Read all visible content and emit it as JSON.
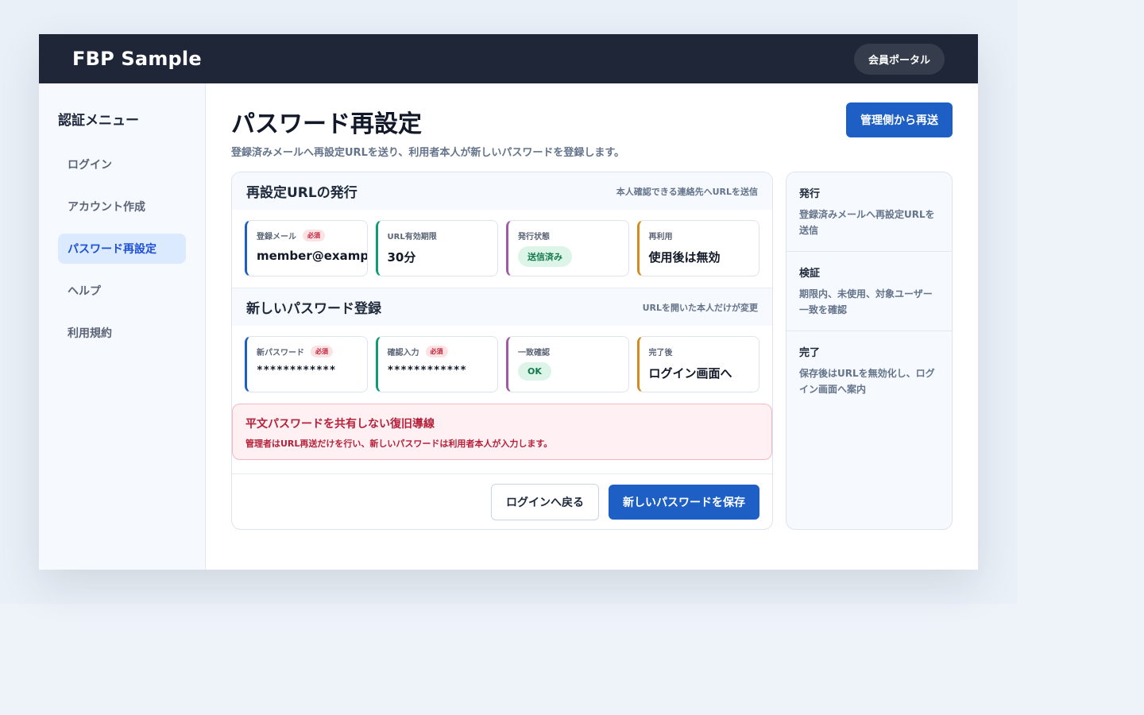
{
  "app": {
    "brand": "FBP Sample",
    "portal_label": "会員ポータル"
  },
  "sidebar": {
    "title": "認証メニュー",
    "items": [
      {
        "label": "ログイン",
        "active": false
      },
      {
        "label": "アカウント作成",
        "active": false
      },
      {
        "label": "パスワード再設定",
        "active": true
      },
      {
        "label": "ヘルプ",
        "active": false
      },
      {
        "label": "利用規約",
        "active": false
      }
    ]
  },
  "page": {
    "title": "パスワード再設定",
    "subtitle": "登録済みメールへ再設定URLを送り、利用者本人が新しいパスワードを登録します。",
    "resend_button": "管理側から再送"
  },
  "issue_section": {
    "title": "再設定URLの発行",
    "note": "本人確認できる連絡先へURLを送信",
    "fields": [
      {
        "label": "登録メール",
        "required_badge": "必須",
        "value": "member@example.com"
      },
      {
        "label": "URL有効期限",
        "value": "30分"
      },
      {
        "label": "発行状態",
        "status": "送信済み"
      },
      {
        "label": "再利用",
        "value": "使用後は無効"
      }
    ]
  },
  "register_section": {
    "title": "新しいパスワード登録",
    "note": "URLを開いた本人だけが変更",
    "fields": [
      {
        "label": "新パスワード",
        "required_badge": "必須",
        "value": "************"
      },
      {
        "label": "確認入力",
        "required_badge": "必須",
        "value": "************"
      },
      {
        "label": "一致確認",
        "status": "OK"
      },
      {
        "label": "完了後",
        "value": "ログイン画面へ"
      }
    ]
  },
  "alert": {
    "title": "平文パスワードを共有しない復旧導線",
    "body": "管理者はURL再送だけを行い、新しいパスワードは利用者本人が入力します。"
  },
  "footer": {
    "back_button": "ログインへ戻る",
    "save_button": "新しいパスワードを保存"
  },
  "steps": [
    {
      "title": "発行",
      "body": "登録済みメールへ再設定URLを送信"
    },
    {
      "title": "検証",
      "body": "期限内、未使用、対象ユーザー一致を確認"
    },
    {
      "title": "完了",
      "body": "保存後はURLを無効化し、ログイン画面へ案内"
    }
  ],
  "colors": {
    "topbar": "#1e2637",
    "accent": "#1d5fc4",
    "success": "#137a4a",
    "danger": "#b5213a"
  }
}
